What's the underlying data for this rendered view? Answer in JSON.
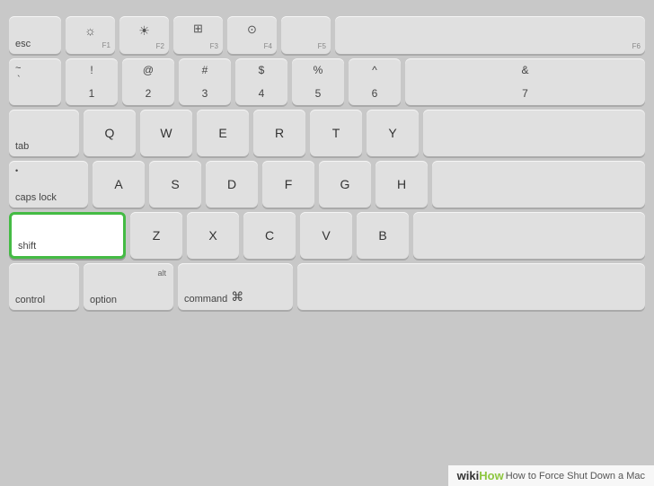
{
  "keyboard": {
    "background_color": "#c8c8c8",
    "key_color": "#e0e0e0",
    "highlight_color": "#ffffff",
    "highlight_border": "#44bb44",
    "rows": {
      "fn_row": {
        "keys": [
          {
            "label": "esc",
            "fn": ""
          },
          {
            "symbol": "☀",
            "label": "",
            "fn": "F1"
          },
          {
            "symbol": "☀",
            "label": "",
            "fn": "F2"
          },
          {
            "symbol": "⊞",
            "label": "",
            "fn": "F3"
          },
          {
            "symbol": "◉",
            "label": "",
            "fn": "F4"
          },
          {
            "label": "",
            "fn": "F5"
          },
          {
            "label": "",
            "fn": "F6"
          }
        ]
      },
      "num_row": {
        "keys": [
          {
            "top": "~",
            "bot": "`"
          },
          {
            "top": "!",
            "bot": "1"
          },
          {
            "top": "@",
            "bot": "2"
          },
          {
            "top": "#",
            "bot": "3"
          },
          {
            "top": "$",
            "bot": "4"
          },
          {
            "top": "%",
            "bot": "5"
          },
          {
            "top": "^",
            "bot": "6"
          },
          {
            "top": "&",
            "bot": "7"
          }
        ]
      },
      "qwerty": [
        "Q",
        "W",
        "E",
        "R",
        "T",
        "Y"
      ],
      "asdf": [
        "A",
        "S",
        "D",
        "F",
        "G",
        "H"
      ],
      "zxcv": [
        "Z",
        "X",
        "C",
        "V",
        "B"
      ],
      "bottom": {
        "control": "control",
        "option": "option",
        "command": "command",
        "command_symbol": "⌘"
      }
    }
  },
  "wikihow": {
    "logo_wiki": "wiki",
    "logo_how": "How",
    "title": "How to Force Shut Down a Mac"
  },
  "highlighted_keys": [
    "shift"
  ]
}
